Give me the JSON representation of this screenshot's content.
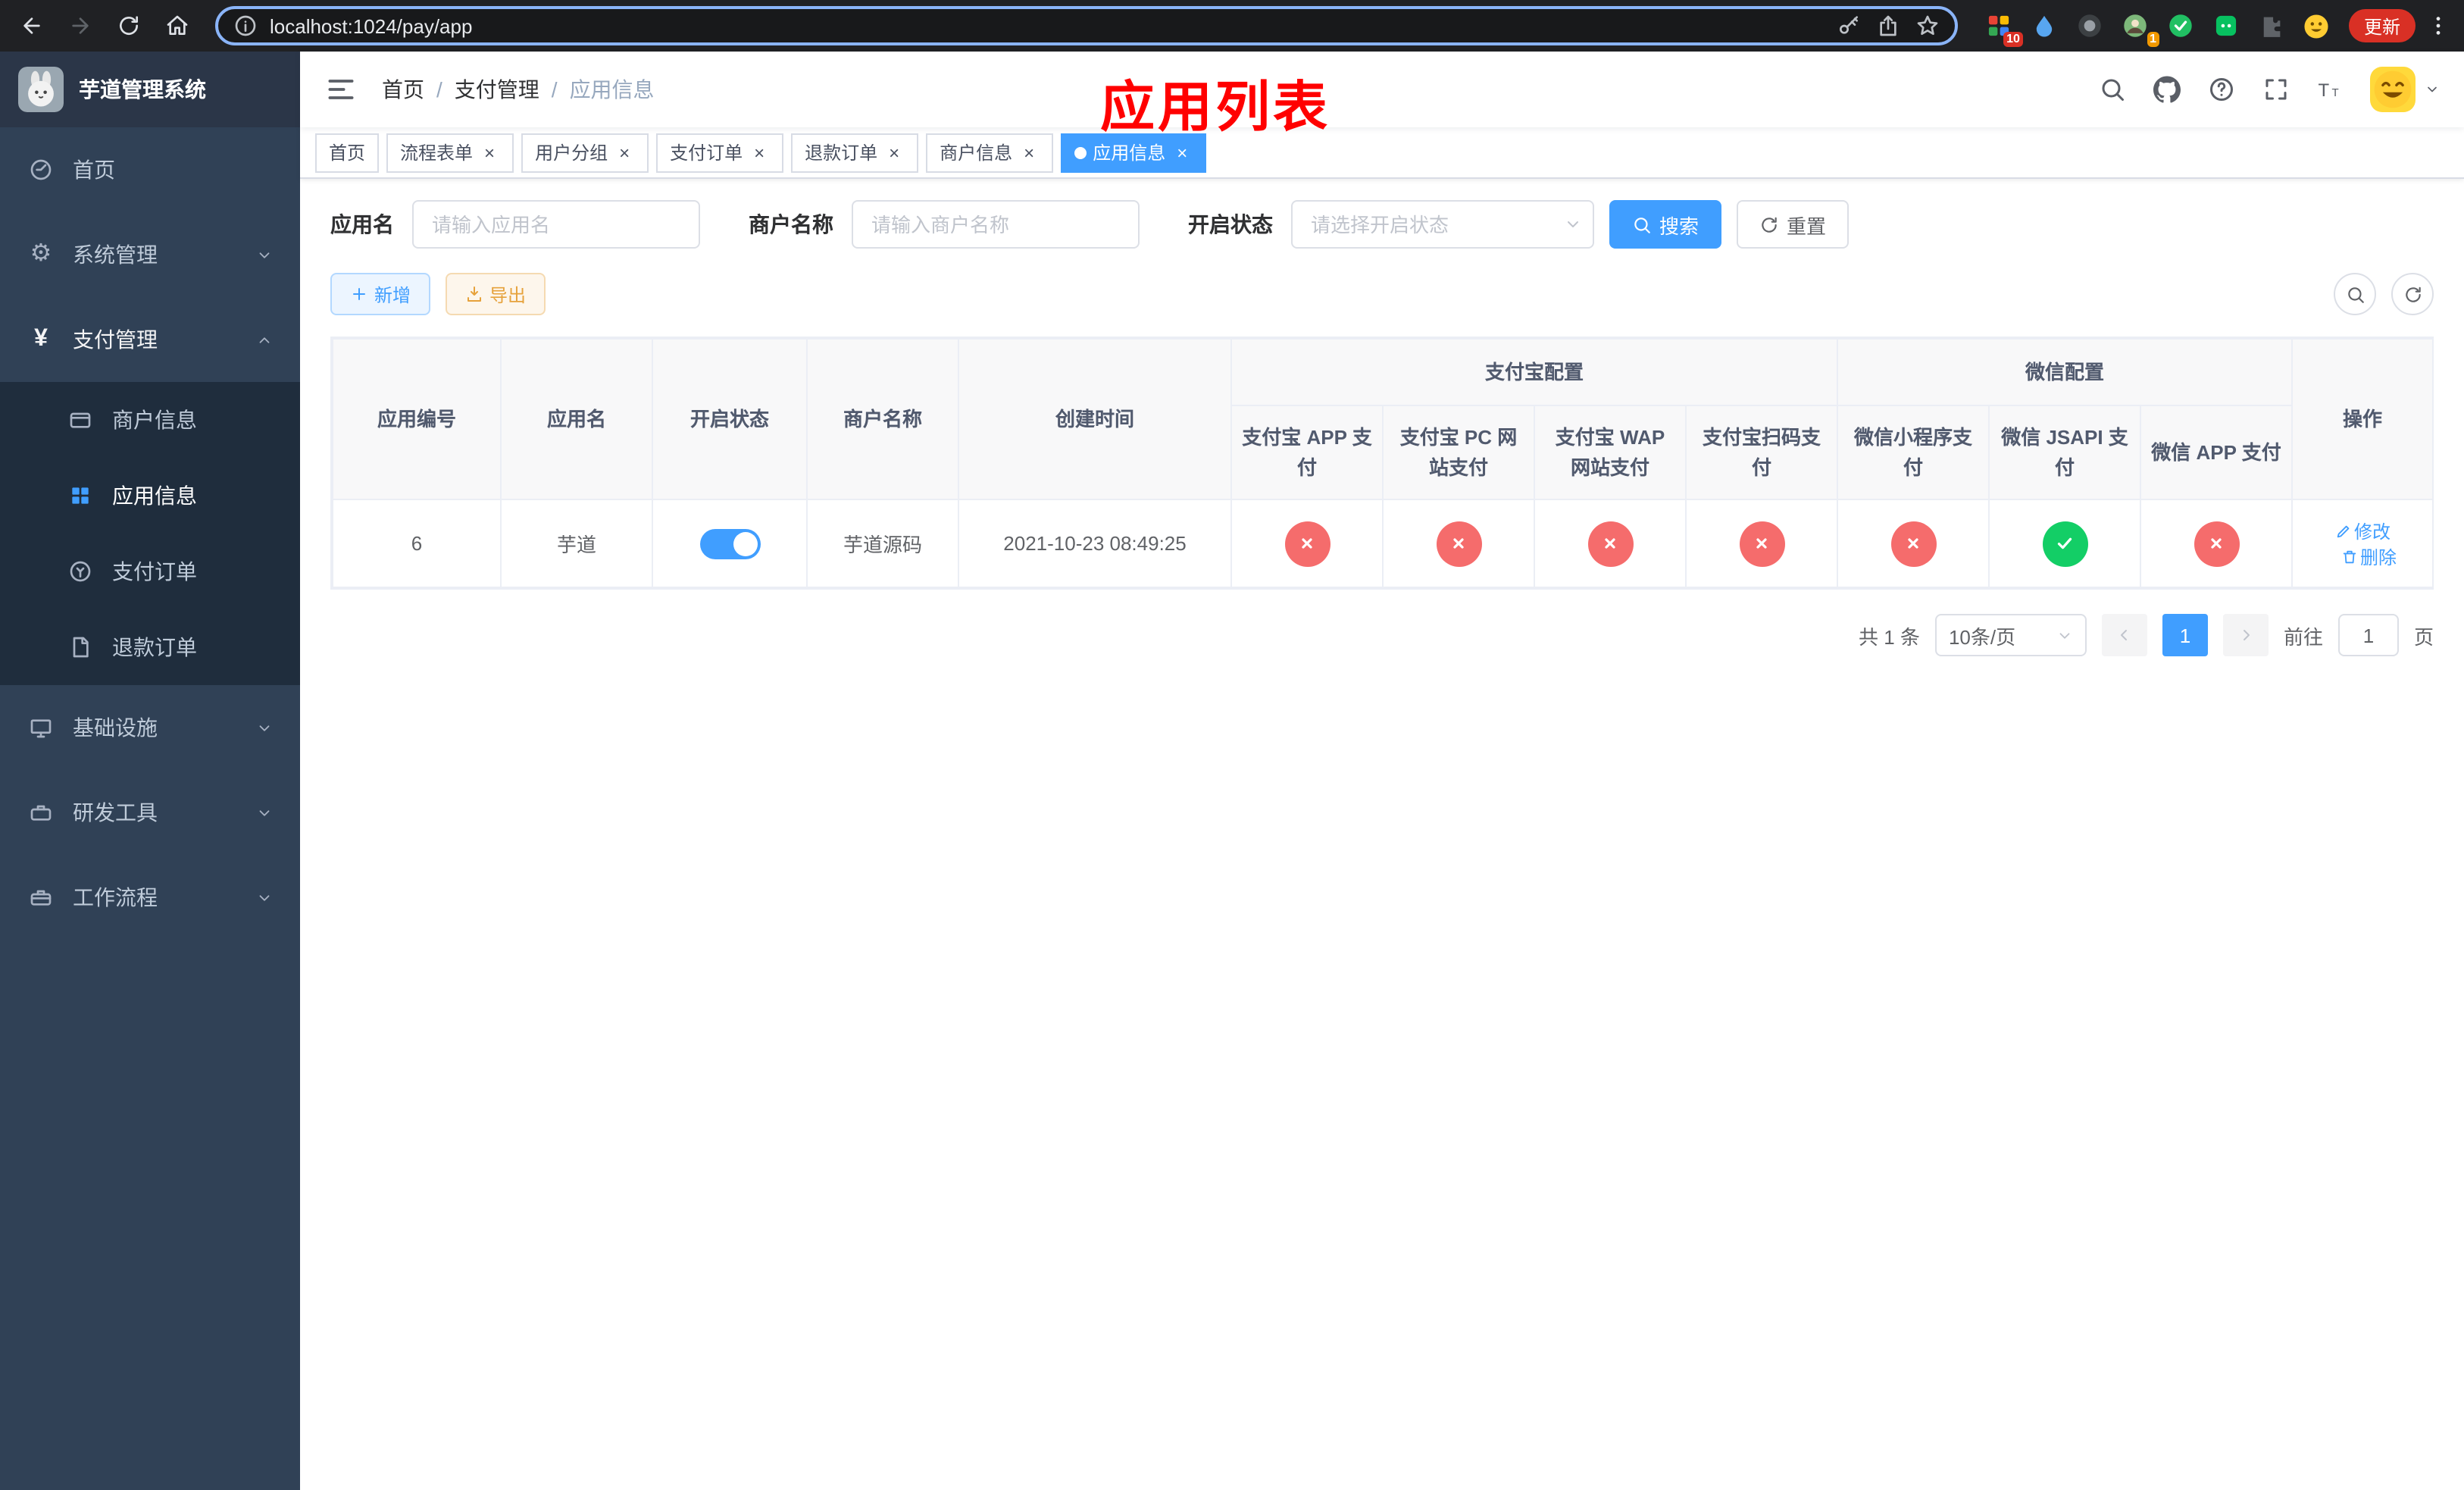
{
  "colors": {
    "primary": "#409eff",
    "success": "#13ce66",
    "danger": "#f56c6c",
    "warning": "#e6a23c",
    "sidebar_bg": "#304156",
    "submenu_bg": "#1f2d3d",
    "annotation": "#ff0000"
  },
  "browser": {
    "url": "localhost:1024/pay/app",
    "update_label": "更新",
    "extensions_badge": "10",
    "profile_badge": "1"
  },
  "sidebar": {
    "app_title": "芋道管理系统",
    "menu": [
      {
        "label": "首页"
      },
      {
        "label": "系统管理"
      },
      {
        "label": "支付管理"
      },
      {
        "label": "基础设施"
      },
      {
        "label": "研发工具"
      },
      {
        "label": "工作流程"
      }
    ],
    "submenu": [
      {
        "label": "商户信息"
      },
      {
        "label": "应用信息"
      },
      {
        "label": "支付订单"
      },
      {
        "label": "退款订单"
      }
    ]
  },
  "header": {
    "breadcrumb": [
      "首页",
      "支付管理",
      "应用信息"
    ],
    "annotation": "应用列表"
  },
  "tabs": [
    {
      "label": "首页"
    },
    {
      "label": "流程表单"
    },
    {
      "label": "用户分组"
    },
    {
      "label": "支付订单"
    },
    {
      "label": "退款订单"
    },
    {
      "label": "商户信息"
    },
    {
      "label": "应用信息"
    }
  ],
  "filters": {
    "app_name_label": "应用名",
    "app_name_placeholder": "请输入应用名",
    "merchant_label": "商户名称",
    "merchant_placeholder": "请输入商户名称",
    "status_label": "开启状态",
    "status_placeholder": "请选择开启状态",
    "search_label": "搜索",
    "reset_label": "重置"
  },
  "toolbar": {
    "add_label": "新增",
    "export_label": "导出"
  },
  "table": {
    "headers": {
      "app_id": "应用编号",
      "app_name": "应用名",
      "status": "开启状态",
      "merchant": "商户名称",
      "create_time": "创建时间",
      "alipay_group": "支付宝配置",
      "wechat_group": "微信配置",
      "actions": "操作",
      "alipay_app": "支付宝 APP 支付",
      "alipay_pc": "支付宝 PC 网站支付",
      "alipay_wap": "支付宝 WAP 网站支付",
      "alipay_scan": "支付宝扫码支付",
      "wechat_mini": "微信小程序支付",
      "wechat_jsapi": "微信 JSAPI 支付",
      "wechat_app": "微信 APP 支付"
    },
    "rows": [
      {
        "app_id": "6",
        "app_name": "芋道",
        "status_on": true,
        "toggle_class": "switch on",
        "merchant": "芋道源码",
        "create_time": "2021-10-23 08:49:25",
        "status_classes": [
          "st red",
          "st red",
          "st red",
          "st red",
          "st red",
          "st green",
          "st red"
        ],
        "edit_label": "修改",
        "delete_label": "删除"
      }
    ]
  },
  "pagination": {
    "total_text": "共 1 条",
    "page_size": "10条/页",
    "current_page": "1",
    "goto_label": "前往",
    "goto_value": "1",
    "page_suffix": "页"
  }
}
